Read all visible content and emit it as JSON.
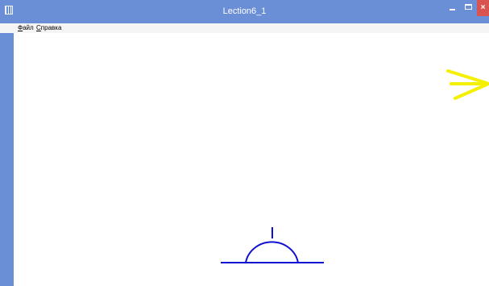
{
  "window": {
    "title": "Lection6_1",
    "close_glyph": "×",
    "colors": {
      "titlebar": "#6b8fd6",
      "close_button": "#d9534f",
      "drawing_stroke": "#1010d0",
      "arrow_stroke": "#f5f000"
    }
  },
  "menu": {
    "file_acc": "Ф",
    "file_rest": "айл",
    "help_acc": "С",
    "help_rest": "правка"
  },
  "icons": {
    "app": "app-icon",
    "minimize": "minimize-icon",
    "maximize": "maximize-icon",
    "close": "close-icon"
  }
}
